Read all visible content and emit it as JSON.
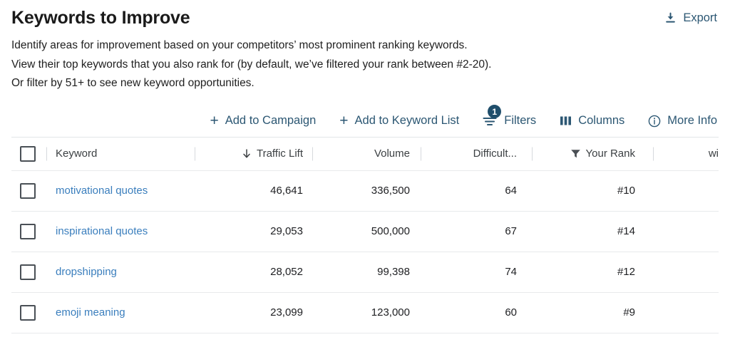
{
  "header": {
    "title": "Keywords to Improve",
    "export_label": "Export",
    "export_icon": "download-icon",
    "description_lines": [
      "Identify areas for improvement based on your competitors’ most prominent ranking keywords.",
      "View their top keywords that you also rank for (by default, we’ve filtered your rank between #2-20).",
      "Or filter by 51+ to see new keyword opportunities."
    ]
  },
  "toolbar": {
    "add_to_campaign_label": "Add to Campaign",
    "add_to_keyword_list_label": "Add to Keyword List",
    "filters_label": "Filters",
    "filters_badge": "1",
    "columns_label": "Columns",
    "more_info_label": "More Info",
    "plus_icon": "plus-icon",
    "filters_icon": "filter-lines-icon",
    "columns_icon": "columns-icon",
    "more_info_icon": "info-circle-icon"
  },
  "table": {
    "select_all_checkbox": "unchecked",
    "columns": {
      "keyword": "Keyword",
      "traffic_lift": "Traffic Lift",
      "volume": "Volume",
      "difficulty": "Difficult...",
      "your_rank": "Your Rank",
      "clipped": "wi"
    },
    "sort": {
      "column": "traffic_lift",
      "direction": "desc",
      "icon": "arrow-down-icon"
    },
    "filtered_column": {
      "column": "your_rank",
      "icon": "funnel-icon"
    },
    "rows": [
      {
        "checkbox": "unchecked",
        "keyword": "motivational quotes",
        "traffic_lift": "46,641",
        "volume": "336,500",
        "difficulty": "64",
        "your_rank": "#10"
      },
      {
        "checkbox": "unchecked",
        "keyword": "inspirational quotes",
        "traffic_lift": "29,053",
        "volume": "500,000",
        "difficulty": "67",
        "your_rank": "#14"
      },
      {
        "checkbox": "unchecked",
        "keyword": "dropshipping",
        "traffic_lift": "28,052",
        "volume": "99,398",
        "difficulty": "74",
        "your_rank": "#12"
      },
      {
        "checkbox": "unchecked",
        "keyword": "emoji meaning",
        "traffic_lift": "23,099",
        "volume": "123,000",
        "difficulty": "60",
        "your_rank": "#9"
      }
    ]
  },
  "colors": {
    "link": "#3a7ebd",
    "action": "#2c5773",
    "badge": "#1f4e6b",
    "border": "#e8eaec"
  }
}
